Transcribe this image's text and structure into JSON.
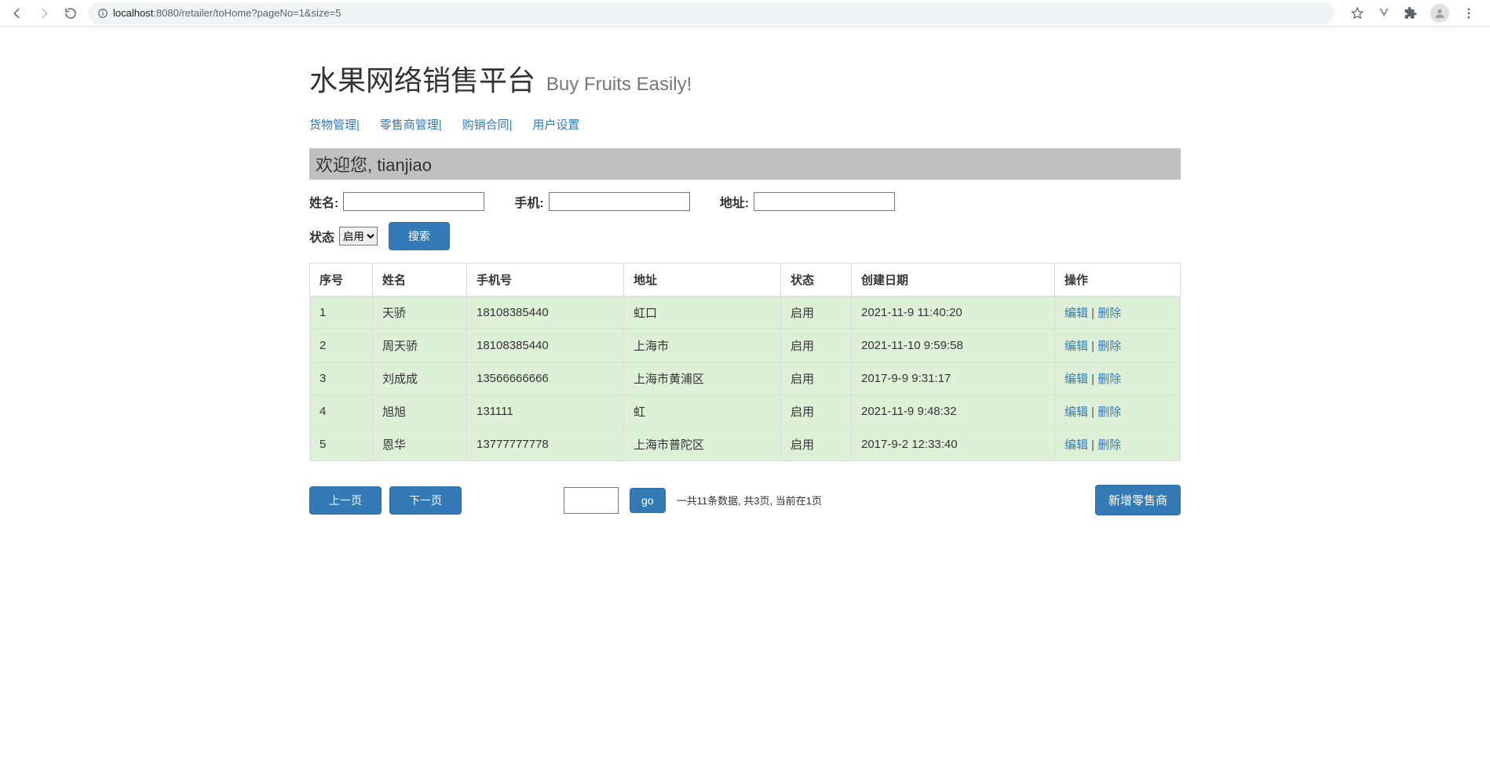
{
  "browser": {
    "url_host": "localhost",
    "url_port_path": ":8080/retailer/toHome?pageNo=1&size=5"
  },
  "header": {
    "title": "水果网络销售平台",
    "subtitle": "Buy Fruits Easily!"
  },
  "nav": {
    "items": [
      "货物管理|",
      "零售商管理|",
      "购销合同|",
      "用户设置"
    ]
  },
  "welcome": "欢迎您, tianjiao",
  "search": {
    "name_label": "姓名:",
    "phone_label": "手机:",
    "address_label": "地址:",
    "status_label": "状态",
    "status_selected": "启用",
    "search_button": "搜索"
  },
  "table": {
    "headers": [
      "序号",
      "姓名",
      "手机号",
      "地址",
      "状态",
      "创建日期",
      "操作"
    ],
    "rows": [
      {
        "index": "1",
        "name": "天骄",
        "phone": "18108385440",
        "address": "虹口",
        "status": "启用",
        "created": "2021-11-9 11:40:20"
      },
      {
        "index": "2",
        "name": "周天骄",
        "phone": "18108385440",
        "address": "上海市",
        "status": "启用",
        "created": "2021-11-10 9:59:58"
      },
      {
        "index": "3",
        "name": "刘成成",
        "phone": "13566666666",
        "address": "上海市黄浦区",
        "status": "启用",
        "created": "2017-9-9 9:31:17"
      },
      {
        "index": "4",
        "name": "旭旭",
        "phone": "131111",
        "address": "虹",
        "status": "启用",
        "created": "2021-11-9 9:48:32"
      },
      {
        "index": "5",
        "name": "恩华",
        "phone": "13777777778",
        "address": "上海市普陀区",
        "status": "启用",
        "created": "2017-9-2 12:33:40"
      }
    ],
    "actions": {
      "edit": "编辑",
      "delete": "删除"
    }
  },
  "pager": {
    "prev": "上一页",
    "next": "下一页",
    "go": "go",
    "info": "一共11条数据, 共3页, 当前在1页",
    "add_button": "新增零售商"
  }
}
